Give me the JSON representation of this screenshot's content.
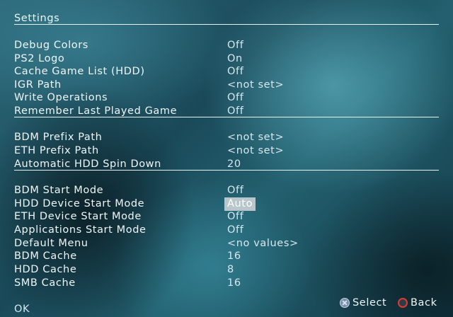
{
  "title": "Settings",
  "groups": [
    {
      "items": [
        {
          "label": "Debug Colors",
          "value": "Off"
        },
        {
          "label": "PS2 Logo",
          "value": "On"
        },
        {
          "label": "Cache Game List (HDD)",
          "value": "Off"
        },
        {
          "label": "IGR Path",
          "value": "<not set>"
        },
        {
          "label": "Write Operations",
          "value": "Off"
        },
        {
          "label": "Remember Last Played Game",
          "value": "Off"
        }
      ]
    },
    {
      "items": [
        {
          "label": "BDM Prefix Path",
          "value": "<not set>"
        },
        {
          "label": "ETH Prefix Path",
          "value": "<not set>"
        },
        {
          "label": "Automatic HDD Spin Down",
          "value": "20"
        }
      ]
    },
    {
      "items": [
        {
          "label": "BDM Start Mode",
          "value": "Off"
        },
        {
          "label": "HDD Device Start Mode",
          "value": "Auto",
          "selected": true
        },
        {
          "label": "ETH Device Start Mode",
          "value": "Off"
        },
        {
          "label": "Applications Start Mode",
          "value": "Off"
        },
        {
          "label": "Default Menu",
          "value": "<no values>"
        },
        {
          "label": "BDM Cache",
          "value": "16"
        },
        {
          "label": "HDD Cache",
          "value": "8"
        },
        {
          "label": "SMB Cache",
          "value": "16"
        }
      ]
    }
  ],
  "footer": {
    "ok_label": "OK",
    "select_label": "Select",
    "back_label": "Back",
    "select_icon": "cross-button-icon",
    "back_icon": "circle-button-icon"
  },
  "colors": {
    "selection_background": "#b9c6cc",
    "circle_button": "#e0392f",
    "text": "#eef6f9"
  }
}
